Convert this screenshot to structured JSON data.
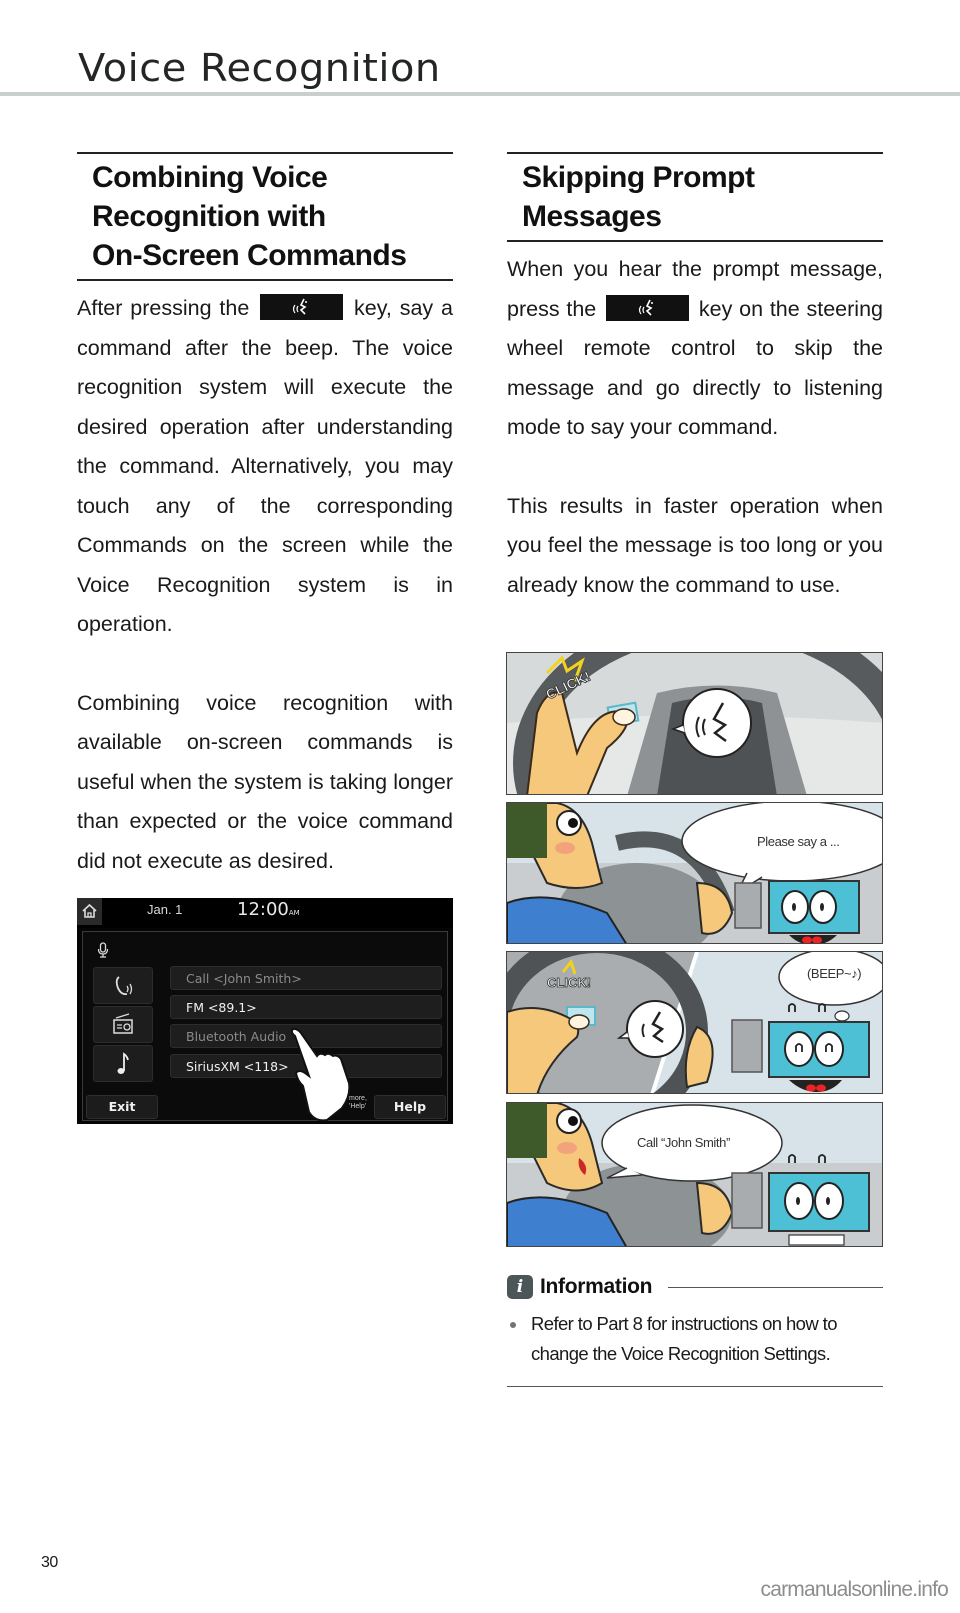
{
  "header": {
    "title": "Voice Recognition"
  },
  "left_section": {
    "heading_lines": [
      "Combining Voice",
      "Recognition with",
      "On-Screen Commands"
    ],
    "para1_before_key": "After pressing the",
    "para1_after_key": "key, say a command after the beep. The voice recognition system will execute the desired operation after understanding the command. Alternatively, you may touch any of the corresponding Commands on the screen while the Voice Recognition system is in operation.",
    "para2": "Combining voice recognition with available on-screen commands is useful when the system is taking longer than expected or the voice command did not execute as desired.",
    "key_icon": "voice-talk-icon"
  },
  "head_unit": {
    "date": "Jan.  1",
    "time": "12:00",
    "time_suffix": "AM",
    "commands": [
      {
        "label": "Call <John Smith>",
        "icon": "phone-icon"
      },
      {
        "label": "FM <89.1>",
        "icon": "radio-icon"
      },
      {
        "label": "Bluetooth Audio",
        "icon": "music-note-icon"
      },
      {
        "label": "SiriusXM <118>"
      }
    ],
    "exit_label": "Exit",
    "help_label": "Help",
    "hint_text": [
      "more,",
      "'Help'"
    ]
  },
  "right_section": {
    "heading_lines": [
      "Skipping Prompt",
      "Messages"
    ],
    "para1_before_key": "When you hear the prompt message, press the",
    "para1_after_key": "key on the steering wheel remote control to skip the message and go directly to listening mode to say your command.",
    "para2": "This results in faster operation when you feel the message is too long or you already know the command to use."
  },
  "comic": {
    "panel1_sfx": "CLICK!",
    "panel2_bubble": "Please say a ...",
    "panel3_sfx": "CLICK!",
    "panel3_bubble": "(BEEP~♪)",
    "panel4_bubble": "Call “John Smith”"
  },
  "information": {
    "badge": "i",
    "title": "Information",
    "items": [
      "Refer to Part 8 for instructions on how to change the Voice Recognition Settings."
    ]
  },
  "footer": {
    "page_number": "30",
    "watermark": "carmanualsonline.info"
  }
}
